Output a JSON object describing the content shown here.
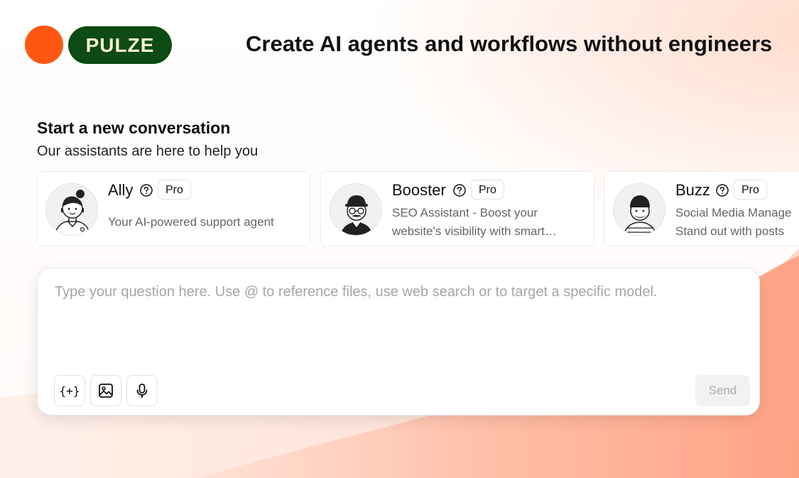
{
  "header": {
    "logo_text": "PULZE",
    "headline": "Create AI agents and workflows without engineers"
  },
  "intro": {
    "title": "Start a new conversation",
    "subtitle": "Our assistants are here to help you"
  },
  "assistants": [
    {
      "name": "Ally",
      "badge": "Pro",
      "description_lines": [
        "Your AI-powered support agent"
      ]
    },
    {
      "name": "Booster",
      "badge": "Pro",
      "description_lines": [
        "SEO Assistant - Boost your",
        "website's visibility with smart…"
      ]
    },
    {
      "name": "Buzz",
      "badge": "Pro",
      "description_lines": [
        "Social Media Manage",
        "Stand out with posts"
      ]
    }
  ],
  "chat": {
    "placeholder": "Type your question here. Use @ to reference files, use web search or to target a specific model.",
    "value": "",
    "variables_button_label": "{+}",
    "send_label": "Send"
  },
  "colors": {
    "logo_dot": "#ff5611",
    "logo_pill_bg": "#0d4a14",
    "logo_pill_text": "#f7f2d0",
    "send_disabled_bg": "#f2f2f2",
    "send_disabled_text": "#a9a9a9",
    "background_accent": "#ffb59a"
  },
  "icons": {
    "help": "question-circle-icon",
    "variables": "braces-plus-icon",
    "image": "image-icon",
    "microphone": "microphone-icon"
  }
}
